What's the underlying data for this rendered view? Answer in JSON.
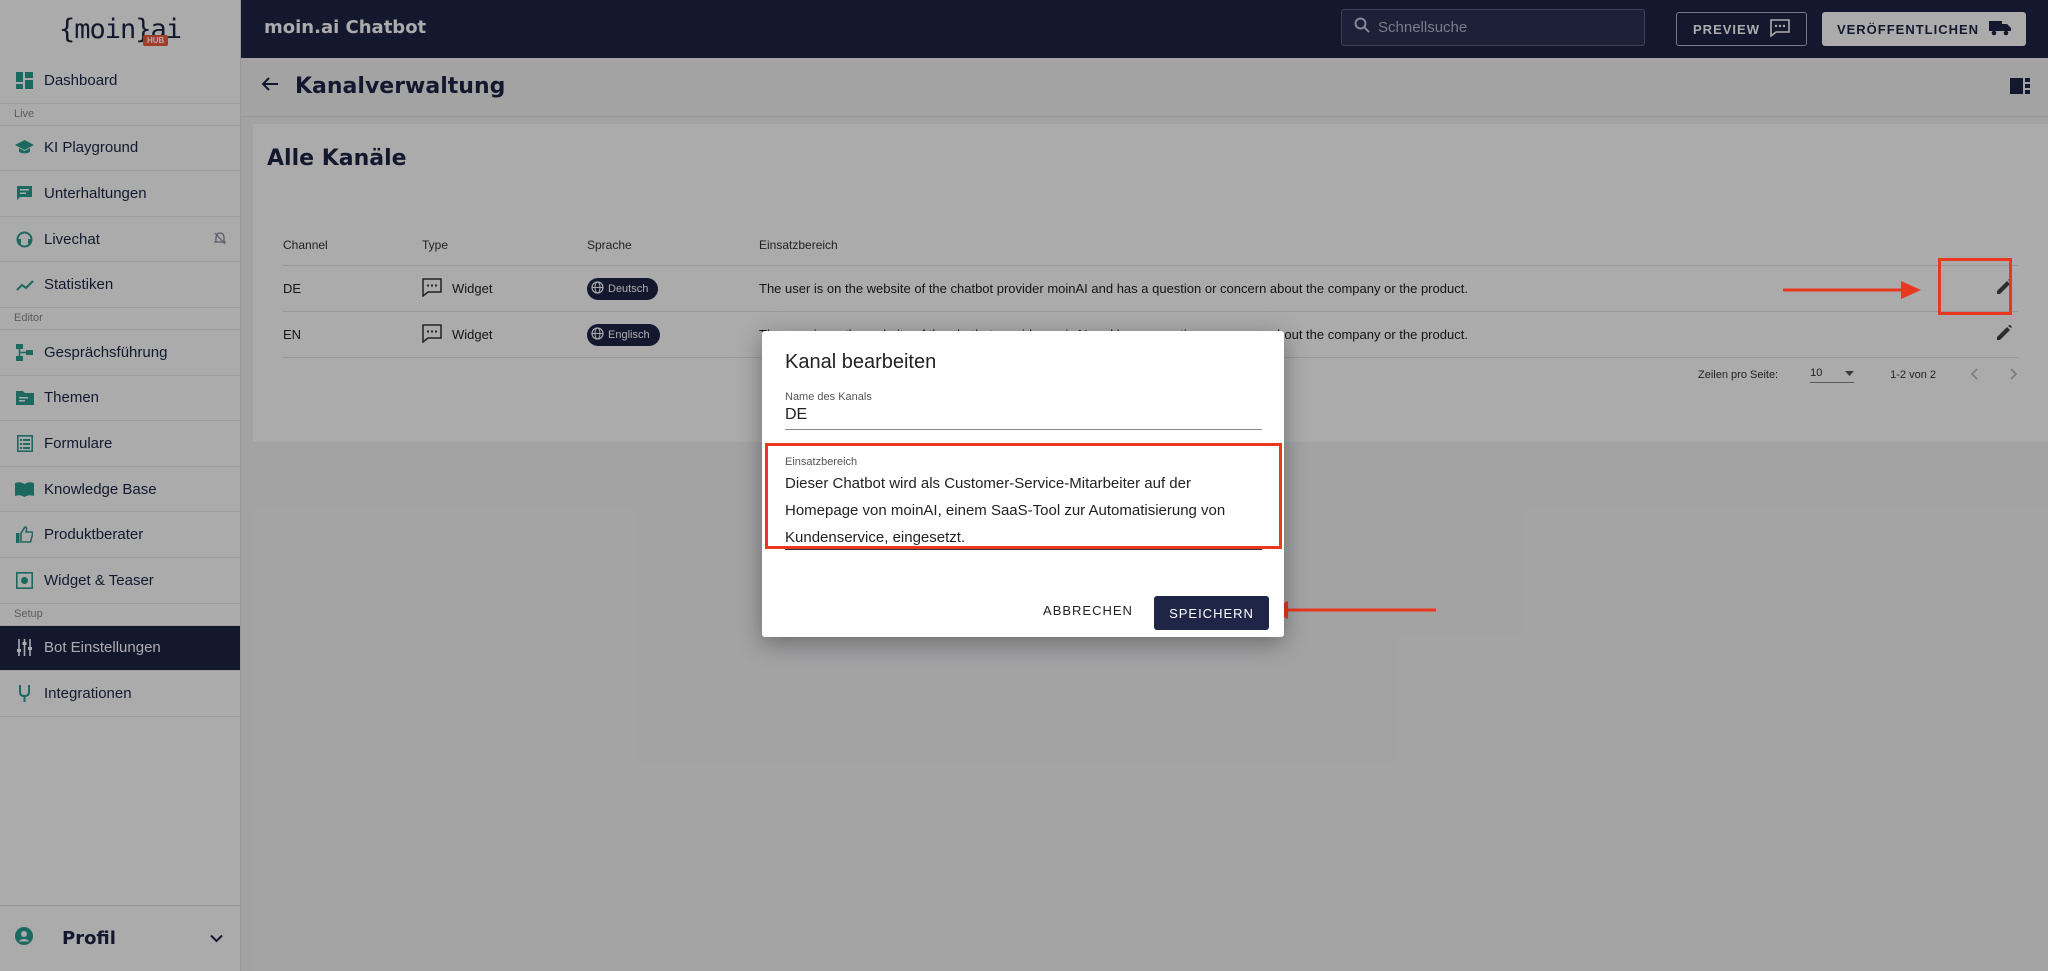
{
  "logo": {
    "text": "{moin}ai",
    "badge": "HUB"
  },
  "sidebar": {
    "items": [
      {
        "label": "Dashboard"
      },
      {
        "label": "KI Playground"
      },
      {
        "label": "Unterhaltungen"
      },
      {
        "label": "Livechat"
      },
      {
        "label": "Statistiken"
      },
      {
        "label": "Gesprächsführung"
      },
      {
        "label": "Themen"
      },
      {
        "label": "Formulare"
      },
      {
        "label": "Knowledge Base"
      },
      {
        "label": "Produktberater"
      },
      {
        "label": "Widget & Teaser"
      },
      {
        "label": "Bot Einstellungen"
      },
      {
        "label": "Integrationen"
      }
    ],
    "sections": {
      "live": "Live",
      "editor": "Editor",
      "setup": "Setup"
    },
    "profile": "Profil"
  },
  "topbar": {
    "title": "moin.ai Chatbot",
    "search_placeholder": "Schnellsuche",
    "preview": "PREVIEW",
    "publish": "VERÖFFENTLICHEN"
  },
  "page": {
    "title": "Kanalverwaltung"
  },
  "card": {
    "title": "Alle Kanäle",
    "columns": [
      "Channel",
      "Type",
      "Sprache",
      "Einsatzbereich"
    ],
    "rows": [
      {
        "channel": "DE",
        "type": "Widget",
        "language": "Deutsch",
        "scope": "The user is on the website of the chatbot provider moinAI and has a question or concern about the company or the product."
      },
      {
        "channel": "EN",
        "type": "Widget",
        "language": "Englisch",
        "scope": "The user is on the website of the chatbot provider moinAI and has a question or concern about the company or the product."
      }
    ],
    "footer": {
      "rows_per_page_label": "Zeilen pro Seite:",
      "rows_per_page": "10",
      "range": "1-2 von 2"
    }
  },
  "dialog": {
    "title": "Kanal bearbeiten",
    "name_label": "Name des Kanals",
    "name_value": "DE",
    "scope_label": "Einsatzbereich",
    "scope_value": "Dieser Chatbot wird als Customer-Service-Mitarbeiter auf der Homepage von moinAI, einem SaaS-Tool zur Automatisierung von Kundenservice, eingesetzt.",
    "cancel": "ABBRECHEN",
    "save": "SPEICHERN"
  },
  "colors": {
    "navy": "#1f2547",
    "annotation_red": "#e8381f",
    "accent_green": "#2a9d8f"
  }
}
